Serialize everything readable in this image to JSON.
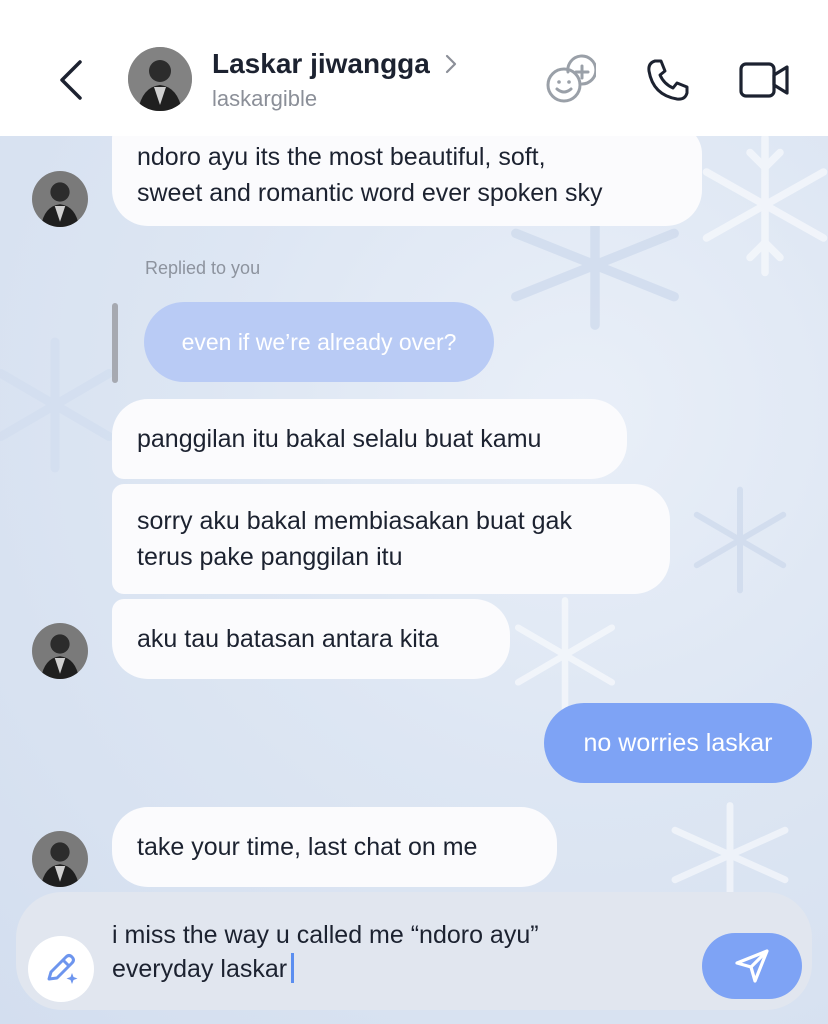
{
  "header": {
    "back_icon": "chevron-left-icon",
    "name": "Laskar jiwangga",
    "username": "laskargible",
    "icons": [
      "sticker-icon",
      "phone-icon",
      "video-icon"
    ]
  },
  "messages": [
    {
      "text": "ndoro ayu its the most beautiful, soft,\nsweet and romantic word ever spoken sky",
      "direction": "incoming"
    },
    {
      "reply_label": "Replied to you",
      "reply_text": "even if we’re already over?",
      "direction": "quote"
    },
    {
      "text": "panggilan itu bakal selalu buat kamu",
      "direction": "incoming"
    },
    {
      "text": "sorry aku bakal membiasakan buat gak\nterus pake panggilan itu",
      "direction": "incoming"
    },
    {
      "text": "aku tau batasan antara kita",
      "direction": "incoming"
    },
    {
      "text": "no worries laskar",
      "direction": "outgoing"
    },
    {
      "text": "take your time, last chat on me",
      "direction": "incoming"
    }
  ],
  "composer": {
    "value": "i miss the way u called me “ndoro ayu”\neveryday laskar",
    "edit_icon": "pencil-sparkle-icon",
    "send_icon": "send-icon"
  },
  "colors": {
    "accent": "#7ea3f5",
    "reply_bubble": "#b9cbf5",
    "incoming_bubble": "#fbfbfd",
    "text": "#1c2230",
    "muted": "#8b8f98"
  }
}
